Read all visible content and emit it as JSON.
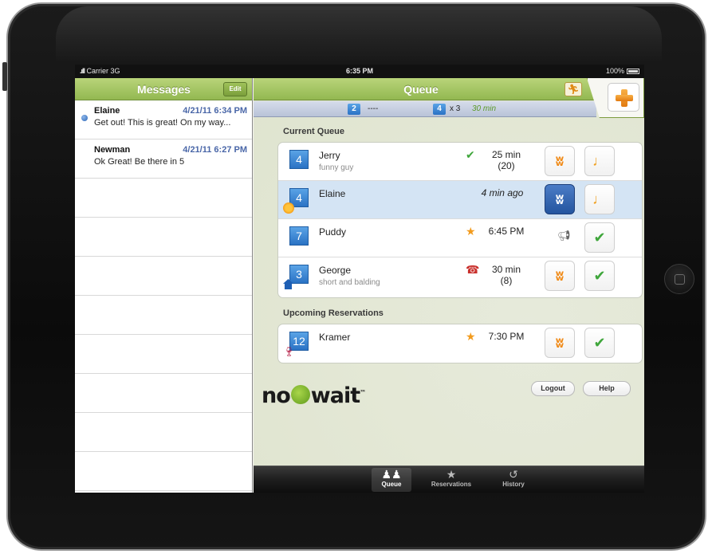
{
  "status_bar": {
    "carrier": "Carrier 3G",
    "signal": ".ıll",
    "time": "6:35 PM",
    "battery": "100%"
  },
  "messages": {
    "title": "Messages",
    "edit_label": "Edit",
    "items": [
      {
        "name": "Elaine",
        "date": "4/21/11 6:34 PM",
        "text": "Get out! This is great! On my way...",
        "unread": true
      },
      {
        "name": "Newman",
        "date": "4/21/11 6:27 PM",
        "text": "Ok Great!  Be there in 5",
        "unread": false
      }
    ]
  },
  "queue": {
    "title": "Queue",
    "walkin_icon": "person-walking-icon",
    "summary": {
      "count_a": "2",
      "text_a": "----",
      "count_b": "4",
      "text_b": "x 3",
      "wait": "30 min"
    },
    "current_title": "Current Queue",
    "current": [
      {
        "party": "4",
        "name": "Jerry",
        "note": "funny guy",
        "status": "check",
        "wait1": "25 min",
        "wait2": "(20)",
        "badge": "",
        "action1": "rss",
        "action2": "chair"
      },
      {
        "party": "4",
        "name": "Elaine",
        "note": "",
        "status": "",
        "wait1": "4 min ago",
        "wait2": "",
        "badge": "sun",
        "action1": "rss-active",
        "action2": "chair"
      },
      {
        "party": "7",
        "name": "Puddy",
        "note": "",
        "status": "star",
        "wait1": "6:45 PM",
        "wait2": "",
        "badge": "",
        "action1": "megaphone",
        "action2": "check"
      },
      {
        "party": "3",
        "name": "George",
        "note": "short and balding",
        "status": "phone",
        "wait1": "30 min",
        "wait2": "(8)",
        "badge": "house",
        "action1": "rss",
        "action2": "check"
      }
    ],
    "upcoming_title": "Upcoming Reservations",
    "upcoming": [
      {
        "party": "12",
        "name": "Kramer",
        "status": "star",
        "wait1": "7:30 PM",
        "badge": "wine",
        "action1": "rss",
        "action2": "check"
      }
    ]
  },
  "logo": {
    "left": "no",
    "right": "wait",
    "tm": "™"
  },
  "buttons": {
    "logout": "Logout",
    "help": "Help"
  },
  "tabbar": {
    "tabs": [
      {
        "label": "Queue",
        "icon": "people-icon",
        "active": true
      },
      {
        "label": "Reservations",
        "icon": "star-icon",
        "active": false
      },
      {
        "label": "History",
        "icon": "history-icon",
        "active": false
      }
    ]
  }
}
